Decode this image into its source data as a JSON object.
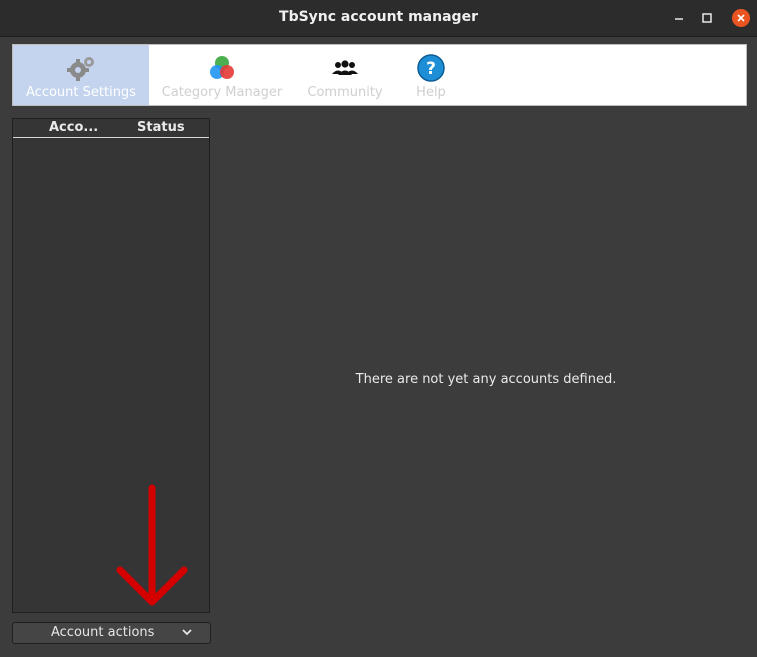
{
  "window": {
    "title": "TbSync account manager"
  },
  "tabs": [
    {
      "label": "Account Settings",
      "icon": "gears-icon",
      "active": true
    },
    {
      "label": "Category Manager",
      "icon": "color-circles-icon",
      "active": false
    },
    {
      "label": "Community",
      "icon": "people-icon",
      "active": false
    },
    {
      "label": "Help",
      "icon": "help-icon",
      "active": false
    }
  ],
  "accounts_list": {
    "col_account": "Acco...",
    "col_status": "Status"
  },
  "main": {
    "message": "There are not yet any accounts defined."
  },
  "account_actions": {
    "label": "Account actions"
  },
  "colors": {
    "accent_close": "#e95420",
    "active_tab": "#c4d4ef",
    "annotation_arrow": "#d40000"
  }
}
